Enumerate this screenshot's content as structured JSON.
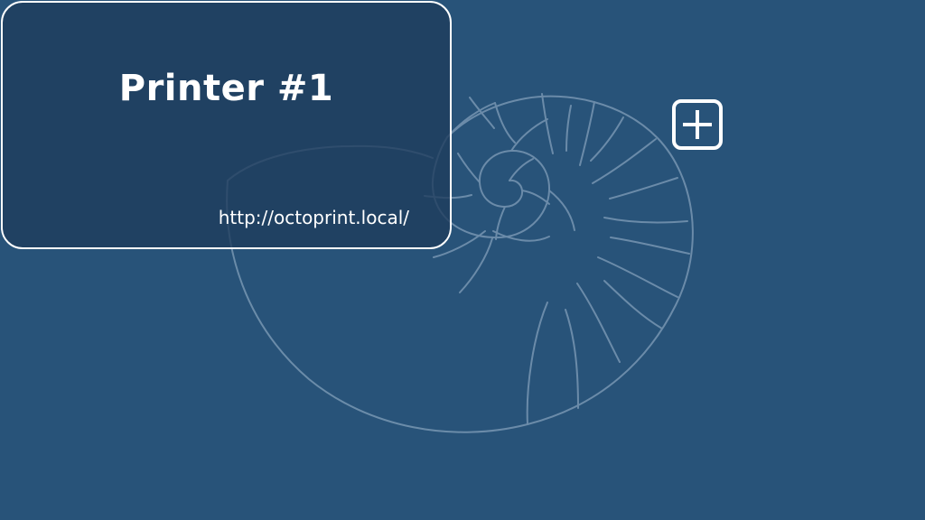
{
  "printers": [
    {
      "name": "Printer #1",
      "url": "http://octoprint.local/"
    }
  ],
  "actions": {
    "add_icon": "plus-square-icon"
  },
  "background": {
    "icon": "nautilus-shell-icon"
  },
  "colors": {
    "background": "#285379",
    "card_fill": "#1f3c5c",
    "card_border": "#ffffff",
    "text": "#ffffff",
    "shell_line": "#6f8fac"
  }
}
